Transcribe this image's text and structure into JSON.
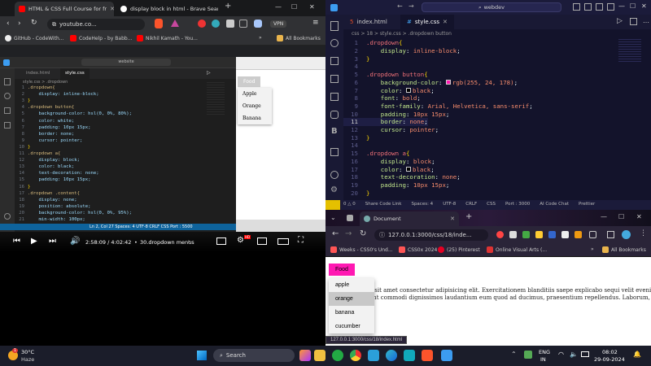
{
  "left_browser": {
    "tabs": [
      {
        "title": "HTML & CSS Full Course for fr",
        "active": true
      },
      {
        "title": "display block in html - Brave Search",
        "active": false
      }
    ],
    "new_tab": "+",
    "url": "youtube.co...",
    "vpn_label": "VPN",
    "bookmarks": [
      "GitHub - CodeWith...",
      "CodeHelp - by Babb...",
      "Nikhil Kamath - You..."
    ],
    "all_bookmarks": "All Bookmarks",
    "video": {
      "editor_search": "website",
      "editor_tabs": [
        "index.html",
        "style.css"
      ],
      "breadcrumb": "style.css > .dropdown",
      "code_lines": [
        {
          "n": "1",
          "t": ".dropdown{"
        },
        {
          "n": "2",
          "t": "    display: inline-block;"
        },
        {
          "n": "3",
          "t": "}"
        },
        {
          "n": "4",
          "t": ".dropdown button{"
        },
        {
          "n": "5",
          "t": "    background-color: hsl(0, 0%, 80%);"
        },
        {
          "n": "6",
          "t": "    color: white;"
        },
        {
          "n": "7",
          "t": "    padding: 10px 15px;"
        },
        {
          "n": "8",
          "t": "    border: none;"
        },
        {
          "n": "9",
          "t": "    cursor: pointer;"
        },
        {
          "n": "10",
          "t": "}"
        },
        {
          "n": "11",
          "t": ".dropdown a{"
        },
        {
          "n": "12",
          "t": "    display: block;"
        },
        {
          "n": "13",
          "t": "    color: black;"
        },
        {
          "n": "14",
          "t": "    text-decoration: none;"
        },
        {
          "n": "15",
          "t": "    padding: 10px 15px;"
        },
        {
          "n": "16",
          "t": "}"
        },
        {
          "n": "17",
          "t": ".dropdown .content{"
        },
        {
          "n": "18",
          "t": "    display: none;"
        },
        {
          "n": "19",
          "t": "    position: absolute;"
        },
        {
          "n": "20",
          "t": "    background-color: hsl(0, 0%, 95%);"
        },
        {
          "n": "21",
          "t": "    min-width: 100px;"
        }
      ],
      "status": "Ln 2, Col 27   Spaces: 4   UTF-8   CRLF   CSS   Port : 5500",
      "preview_button": "Food",
      "preview_items": [
        "Apple",
        "Orange",
        "Banana"
      ],
      "time": "2:58:09 / 4:02:42",
      "chapter": "30.dropdown menus",
      "progress": 0.735
    }
  },
  "right_editor": {
    "search": "webdev",
    "tabs": [
      "index.html",
      "style.css"
    ],
    "breadcrumb": "css > 18 > style.css > .dropdown button",
    "code_lines": [
      {
        "n": "1",
        "parts": [
          [
            ".dropdown",
            "rsel"
          ],
          [
            "{",
            "br"
          ]
        ]
      },
      {
        "n": "2",
        "parts": [
          [
            "    display",
            "rprop"
          ],
          [
            ": ",
            "rtxt"
          ],
          [
            "inline-block",
            "rval"
          ],
          [
            ";",
            "rtxt"
          ]
        ]
      },
      {
        "n": "3",
        "parts": [
          [
            "}",
            "br"
          ]
        ]
      },
      {
        "n": "4",
        "parts": [
          [
            "",
            "rtxt"
          ]
        ]
      },
      {
        "n": "5",
        "parts": [
          [
            ".dropdown button",
            "rsel"
          ],
          [
            "{",
            "br"
          ]
        ]
      },
      {
        "n": "6",
        "parts": [
          [
            "    background-color",
            "rprop"
          ],
          [
            ": ",
            "rtxt"
          ],
          [
            "rgb(255, 24, 178)",
            "rval"
          ],
          [
            ";",
            "rtxt"
          ]
        ]
      },
      {
        "n": "7",
        "parts": [
          [
            "    color",
            "rprop"
          ],
          [
            ": ",
            "rtxt"
          ],
          [
            "black",
            "rval"
          ],
          [
            ";",
            "rtxt"
          ]
        ]
      },
      {
        "n": "8",
        "parts": [
          [
            "    font",
            "rprop"
          ],
          [
            ": ",
            "rtxt"
          ],
          [
            "bold",
            "rval"
          ],
          [
            ";",
            "rtxt"
          ]
        ]
      },
      {
        "n": "9",
        "parts": [
          [
            "    font-family",
            "rprop"
          ],
          [
            ": ",
            "rtxt"
          ],
          [
            "Arial, Helvetica, sans-serif",
            "rval"
          ],
          [
            ";",
            "rtxt"
          ]
        ]
      },
      {
        "n": "10",
        "parts": [
          [
            "    padding",
            "rprop"
          ],
          [
            ": ",
            "rtxt"
          ],
          [
            "10px 15px",
            "rval"
          ],
          [
            ";",
            "rtxt"
          ]
        ]
      },
      {
        "n": "11",
        "parts": [
          [
            "    border",
            "rprop"
          ],
          [
            ": ",
            "rtxt"
          ],
          [
            "none",
            "rval"
          ],
          [
            ";",
            "rtxt"
          ]
        ]
      },
      {
        "n": "12",
        "parts": [
          [
            "    cursor",
            "rprop"
          ],
          [
            ": ",
            "rtxt"
          ],
          [
            "pointer",
            "rval"
          ],
          [
            ";",
            "rtxt"
          ]
        ]
      },
      {
        "n": "13",
        "parts": [
          [
            "}",
            "br"
          ]
        ]
      },
      {
        "n": "14",
        "parts": [
          [
            "",
            "rtxt"
          ]
        ]
      },
      {
        "n": "15",
        "parts": [
          [
            ".dropdown a",
            "rsel"
          ],
          [
            "{",
            "br"
          ]
        ]
      },
      {
        "n": "16",
        "parts": [
          [
            "    display",
            "rprop"
          ],
          [
            ": ",
            "rtxt"
          ],
          [
            "block",
            "rval"
          ],
          [
            ";",
            "rtxt"
          ]
        ]
      },
      {
        "n": "17",
        "parts": [
          [
            "    color",
            "rprop"
          ],
          [
            ": ",
            "rtxt"
          ],
          [
            "black",
            "rval"
          ],
          [
            ";",
            "rtxt"
          ]
        ]
      },
      {
        "n": "18",
        "parts": [
          [
            "    text-decoration",
            "rprop"
          ],
          [
            ": ",
            "rtxt"
          ],
          [
            "none",
            "rval"
          ],
          [
            ";",
            "rtxt"
          ]
        ]
      },
      {
        "n": "19",
        "parts": [
          [
            "    padding",
            "rprop"
          ],
          [
            ": ",
            "rtxt"
          ],
          [
            "10px 15px",
            "rval"
          ],
          [
            ";",
            "rtxt"
          ]
        ]
      },
      {
        "n": "20",
        "parts": [
          [
            "}",
            "br"
          ]
        ]
      }
    ],
    "swatch_color": "#ff18b2",
    "status_items": [
      "0 △ 0",
      "Share Code Link",
      "Spaces: 4",
      "UTF-8",
      "CRLF",
      "CSS",
      "Port : 3000",
      "AI Code Chat",
      "Prettier"
    ]
  },
  "right_browser": {
    "tab_title": "Document",
    "url": "127.0.0.1:3000/css/18/inde...",
    "bookmarks": [
      "Weeks - CSS0's Und...",
      "CSS0x 2024",
      "(25) Pinterest",
      "Online Visual Arts (..."
    ],
    "all_bookmarks": "All Bookmarks",
    "button_label": "Food",
    "button_color": "#ff18b2",
    "menu_items": [
      "apple",
      "orange",
      "banana",
      "cucumber"
    ],
    "hovered_item": "orange",
    "lorem_1": "olor sit amet consectetur adipisicing elit. Exercitationem blanditiis saepe explicabo sequi velit eveniet",
    "lorem_2": "sciunt commodi dignissimos laudantium eum quod ad ducimus, praesentium repellendus. Laborum,",
    "status_url": "127.0.0.1:3000/css/18/index.html"
  },
  "taskbar": {
    "weather_temp": "30°C",
    "weather_desc": "Haze",
    "search_label": "Search",
    "lang_1": "ENG",
    "lang_2": "IN",
    "time": "08:02",
    "date": "29-09-2024",
    "notification_badge": "1"
  }
}
